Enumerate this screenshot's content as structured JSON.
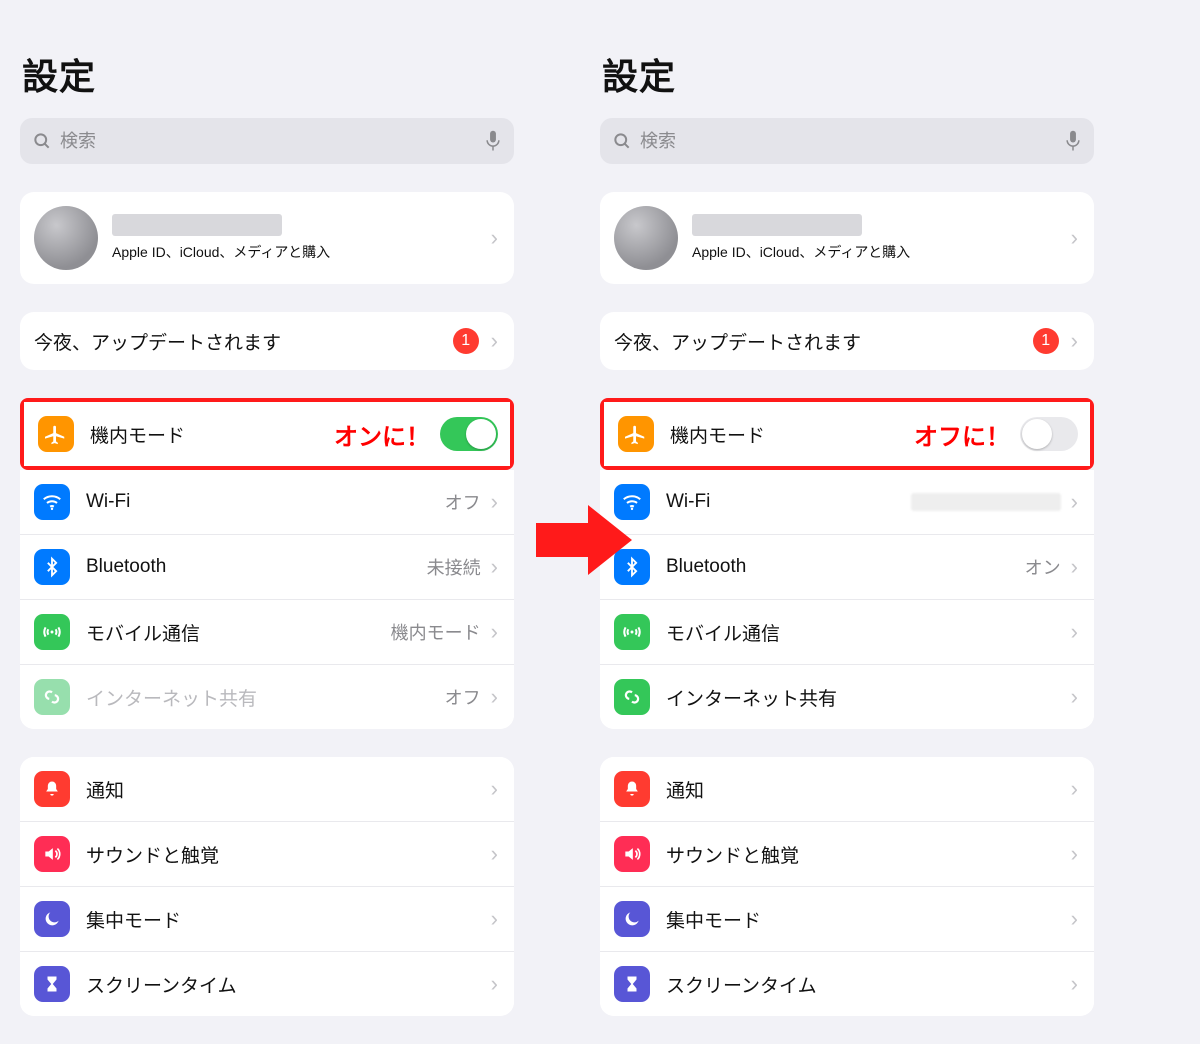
{
  "left": {
    "title": "設定",
    "search_placeholder": "検索",
    "profile_sub": "Apple ID、iCloud、メディアと購入",
    "update_row": {
      "label": "今夜、アップデートされます",
      "badge": "1"
    },
    "airplane": {
      "label": "機内モード",
      "callout": "オンに！",
      "toggle_on": true
    },
    "wifi": {
      "label": "Wi-Fi",
      "value": "オフ"
    },
    "bluetooth": {
      "label": "Bluetooth",
      "value": "未接続"
    },
    "cellular": {
      "label": "モバイル通信",
      "value": "機内モード"
    },
    "hotspot": {
      "label": "インターネット共有",
      "value": "オフ",
      "dim": true
    },
    "notify": {
      "label": "通知"
    },
    "sound": {
      "label": "サウンドと触覚"
    },
    "focus": {
      "label": "集中モード"
    },
    "screentime": {
      "label": "スクリーンタイム"
    }
  },
  "right": {
    "title": "設定",
    "search_placeholder": "検索",
    "profile_sub": "Apple ID、iCloud、メディアと購入",
    "update_row": {
      "label": "今夜、アップデートされます",
      "badge": "1"
    },
    "airplane": {
      "label": "機内モード",
      "callout": "オフに！",
      "toggle_on": false
    },
    "wifi": {
      "label": "Wi-Fi",
      "value_blurred": true
    },
    "bluetooth": {
      "label": "Bluetooth",
      "value": "オン"
    },
    "cellular": {
      "label": "モバイル通信",
      "value": ""
    },
    "hotspot": {
      "label": "インターネット共有",
      "value": ""
    },
    "notify": {
      "label": "通知"
    },
    "sound": {
      "label": "サウンドと触覚"
    },
    "focus": {
      "label": "集中モード"
    },
    "screentime": {
      "label": "スクリーンタイム"
    }
  }
}
